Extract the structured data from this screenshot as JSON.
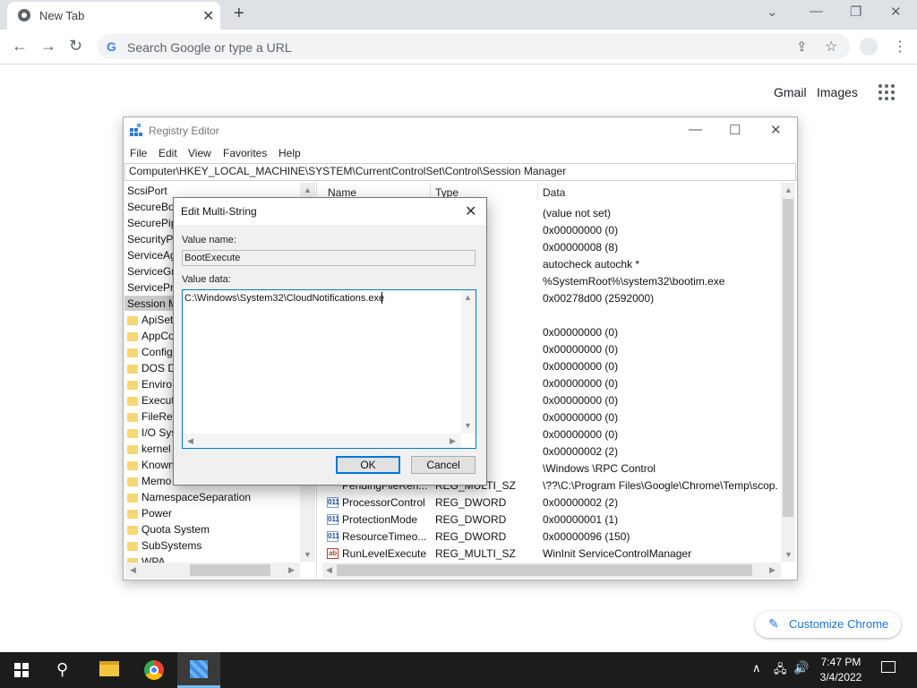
{
  "browser": {
    "tab_title": "New Tab",
    "tab_close_glyph": "✕",
    "new_tab_glyph": "+",
    "omnibox_placeholder": "Search Google or type a URL",
    "google_g": "G",
    "links": {
      "gmail": "Gmail",
      "images": "Images"
    },
    "customize_label": "Customize Chrome",
    "accent_color": "#1a73e8",
    "icons": [
      "back-icon",
      "forward-icon",
      "reload-icon",
      "share-icon",
      "star-icon",
      "profile-icon",
      "menu-dots-icon",
      "apps-grid-icon",
      "pencil-icon"
    ]
  },
  "regedit": {
    "title": "Registry Editor",
    "menu": [
      "File",
      "Edit",
      "View",
      "Favorites",
      "Help"
    ],
    "address": "Computer\\HKEY_LOCAL_MACHINE\\SYSTEM\\CurrentControlSet\\Control\\Session Manager",
    "tree": [
      {
        "label": "ScsiPort",
        "sub": false
      },
      {
        "label": "SecureBo",
        "sub": false
      },
      {
        "label": "SecurePip",
        "sub": false
      },
      {
        "label": "SecurityPr",
        "sub": false
      },
      {
        "label": "ServiceAg",
        "sub": false
      },
      {
        "label": "ServiceGr",
        "sub": false
      },
      {
        "label": "ServicePr",
        "sub": false
      },
      {
        "label": "Session M",
        "sub": false,
        "selected": true
      },
      {
        "label": "ApiSet",
        "sub": true
      },
      {
        "label": "AppCo",
        "sub": true
      },
      {
        "label": "Config",
        "sub": true
      },
      {
        "label": "DOS D",
        "sub": true
      },
      {
        "label": "Enviro",
        "sub": true
      },
      {
        "label": "Execut",
        "sub": true
      },
      {
        "label": "FileRe",
        "sub": true
      },
      {
        "label": "I/O Sys",
        "sub": true
      },
      {
        "label": "kernel",
        "sub": true
      },
      {
        "label": "Known",
        "sub": true
      },
      {
        "label": "Memo",
        "sub": true
      },
      {
        "label": "NamespaceSeparation",
        "sub": true
      },
      {
        "label": "Power",
        "sub": true
      },
      {
        "label": "Quota System",
        "sub": true
      },
      {
        "label": "SubSystems",
        "sub": true
      },
      {
        "label": "WPA",
        "sub": true
      }
    ],
    "columns": {
      "name": "Name",
      "type": "Type",
      "data": "Data"
    },
    "rows": [
      {
        "name": "",
        "type": "",
        "data": "(value not set)"
      },
      {
        "name": "",
        "type": "RD",
        "data": "0x00000000 (0)"
      },
      {
        "name": "",
        "type": "RD",
        "data": "0x00000008 (8)"
      },
      {
        "name": "",
        "type": "_SZ",
        "data": "autocheck autochk *"
      },
      {
        "name": "",
        "type": "ND_SZ",
        "data": "%SystemRoot%\\system32\\bootim.exe"
      },
      {
        "name": "",
        "type": "RD",
        "data": "0x00278d00 (2592000)"
      },
      {
        "name": "",
        "type": "_SZ",
        "data": ""
      },
      {
        "name": "",
        "type": "RD",
        "data": "0x00000000 (0)"
      },
      {
        "name": "",
        "type": "RD",
        "data": "0x00000000 (0)"
      },
      {
        "name": "",
        "type": "RD",
        "data": "0x00000000 (0)"
      },
      {
        "name": "",
        "type": "RD",
        "data": "0x00000000 (0)"
      },
      {
        "name": "",
        "type": "RD",
        "data": "0x00000000 (0)"
      },
      {
        "name": "",
        "type": "RD",
        "data": "0x00000000 (0)"
      },
      {
        "name": "",
        "type": "RD",
        "data": "0x00000000 (0)"
      },
      {
        "name": "",
        "type": "RD",
        "data": "0x00000002 (2)"
      },
      {
        "name": "",
        "type": "_SZ",
        "data": "\\Windows \\RPC Control"
      },
      {
        "name": "PendingFileRen...",
        "type": "REG_MULTI_SZ",
        "data": "\\??\\C:\\Program Files\\Google\\Chrome\\Temp\\scop."
      },
      {
        "name": "ProcessorControl",
        "type": "REG_DWORD",
        "data": "0x00000002 (2)",
        "icon": "bin"
      },
      {
        "name": "ProtectionMode",
        "type": "REG_DWORD",
        "data": "0x00000001 (1)",
        "icon": "bin"
      },
      {
        "name": "ResourceTimeo...",
        "type": "REG_DWORD",
        "data": "0x00000096 (150)",
        "icon": "bin"
      },
      {
        "name": "RunLevelExecute",
        "type": "REG_MULTI_SZ",
        "data": "WinInit ServiceControlManager",
        "icon": "str"
      }
    ],
    "icon_text": {
      "bin": "011",
      "str": "ab"
    }
  },
  "dialog": {
    "title": "Edit Multi-String",
    "value_name_label": "Value name:",
    "value_name": "BootExecute",
    "value_data_label": "Value data:",
    "value_data": "C:\\Windows\\System32\\CloudNotifications.exe",
    "ok_label": "OK",
    "cancel_label": "Cancel"
  },
  "taskbar": {
    "time": "7:47 PM",
    "date": "3/4/2022"
  }
}
